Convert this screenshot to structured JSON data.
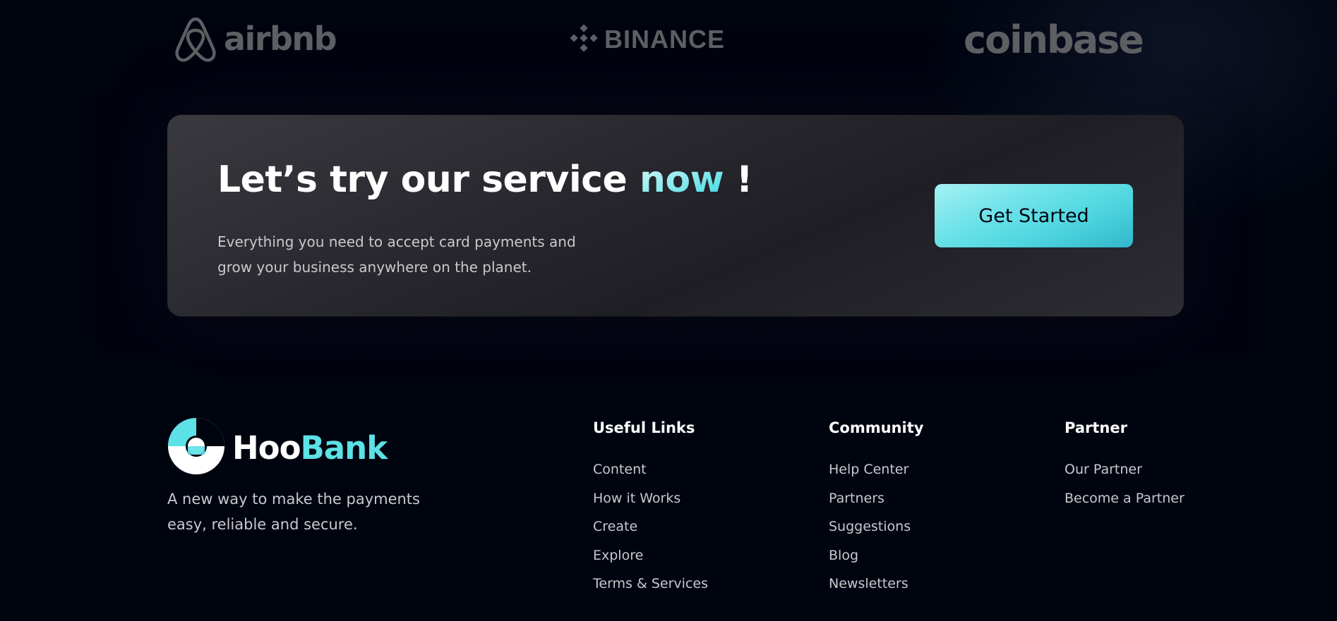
{
  "clients": [
    {
      "name": "airbnb",
      "icon": "airbnb-logo-icon"
    },
    {
      "name": "BINANCE",
      "icon": "binance-logo-icon"
    },
    {
      "name": "coinbase",
      "icon": ""
    }
  ],
  "cta": {
    "title_main": "Let’s try our service ",
    "title_accent": "now",
    "title_end": " !",
    "text": "Everything you need to accept card payments and grow your business anywhere on the planet.",
    "button_label": "Get Started"
  },
  "footer": {
    "brand": {
      "name_part1": "Hoo",
      "name_part2": "Bank",
      "icon": "hoobank-logo-icon"
    },
    "tagline": "A new way to make the payments easy, reliable and secure.",
    "columns": [
      {
        "title": "Useful Links",
        "links": [
          "Content",
          "How it Works",
          "Create",
          "Explore",
          "Terms & Services"
        ]
      },
      {
        "title": "Community",
        "links": [
          "Help Center",
          "Partners",
          "Suggestions",
          "Blog",
          "Newsletters"
        ]
      },
      {
        "title": "Partner",
        "links": [
          "Our Partner",
          "Become a Partner"
        ]
      }
    ]
  },
  "colors": {
    "background": "#00040f",
    "accent": "#5ce1e6",
    "muted_logo": "#5f6064",
    "text_dim": "#c9c9ce"
  }
}
